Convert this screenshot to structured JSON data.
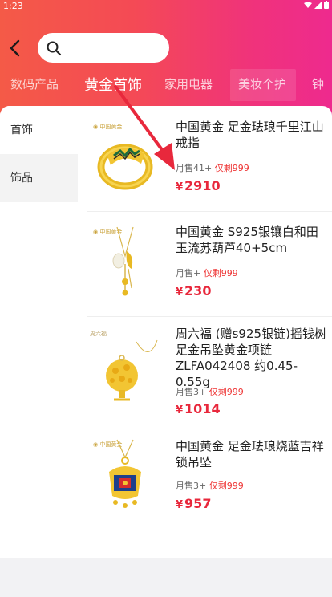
{
  "status_bar": {
    "time": "1:23"
  },
  "header": {
    "search_placeholder": "",
    "tabs": [
      {
        "label": "数码产品"
      },
      {
        "label": "黄金首饰"
      },
      {
        "label": "家用电器"
      },
      {
        "label": "美妆个护"
      },
      {
        "label": "钟"
      }
    ],
    "active_tab": "黄金首饰"
  },
  "sidebar": {
    "items": [
      {
        "label": "首饰"
      },
      {
        "label": "饰品"
      }
    ]
  },
  "products": [
    {
      "title": "中国黄金 足金珐琅千里江山戒指",
      "sales": "月售41+",
      "stock": "仅剩999",
      "currency": "¥",
      "price": "2910"
    },
    {
      "title": "中国黄金 S925银镶白和田玉流苏葫芦40+5cm",
      "sales": "月售+",
      "stock": "仅剩999",
      "currency": "¥",
      "price": "230"
    },
    {
      "title": "周六福 (赠s925银链)摇钱树足金吊坠黄金项链ZLFA042408 约0.45-0.55g",
      "sales": "月售3+",
      "stock": "仅剩999",
      "currency": "¥",
      "price": "1014"
    },
    {
      "title": "中国黄金 足金珐琅烧蓝吉祥锁吊坠",
      "sales": "月售3+",
      "stock": "仅剩999",
      "currency": "¥",
      "price": "957"
    }
  ],
  "colors": {
    "accent_red": "#e8283c",
    "header_start": "#f45a47",
    "header_end": "#ee2a8e"
  }
}
